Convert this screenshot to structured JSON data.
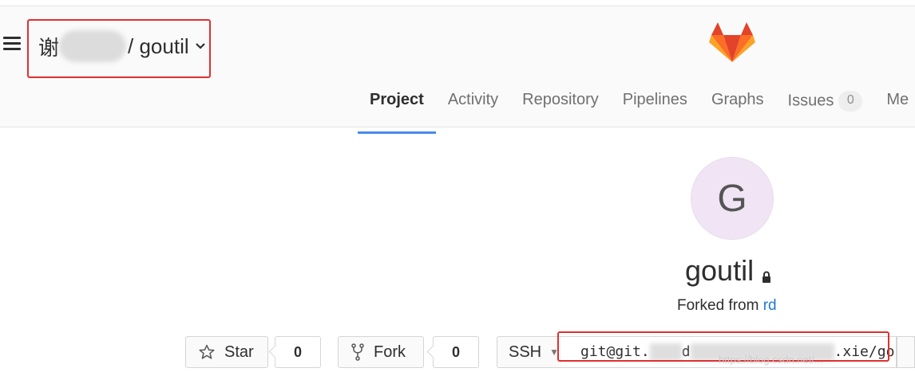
{
  "header": {
    "owner_visible": "谢",
    "project_path": "/ goutil",
    "chevron": "⌄"
  },
  "nav": {
    "items": [
      {
        "label": "Project",
        "active": true
      },
      {
        "label": "Activity"
      },
      {
        "label": "Repository"
      },
      {
        "label": "Pipelines"
      },
      {
        "label": "Graphs"
      },
      {
        "label": "Issues",
        "badge": "0"
      },
      {
        "label": "Me"
      }
    ]
  },
  "project": {
    "avatar_letter": "G",
    "name": "goutil",
    "forked_prefix": "Forked from",
    "forked_source": "rd"
  },
  "actions": {
    "star_label": "Star",
    "star_count": "0",
    "fork_label": "Fork",
    "fork_count": "0",
    "protocol": "SSH",
    "clone_url_start": "git@git.",
    "clone_url_mid": "d",
    "clone_url_end": ".xie/go"
  },
  "watermark": "https://blog.csdn.net/...",
  "colors": {
    "accent": "#4a8bee",
    "link": "#1f78d1",
    "highlight_box": "#e03030",
    "avatar_bg": "#f1e5f5"
  },
  "icons": {
    "menu": "hamburger-icon",
    "logo": "gitlab-logo",
    "lock": "lock-icon",
    "star": "star-icon",
    "fork": "fork-icon"
  }
}
